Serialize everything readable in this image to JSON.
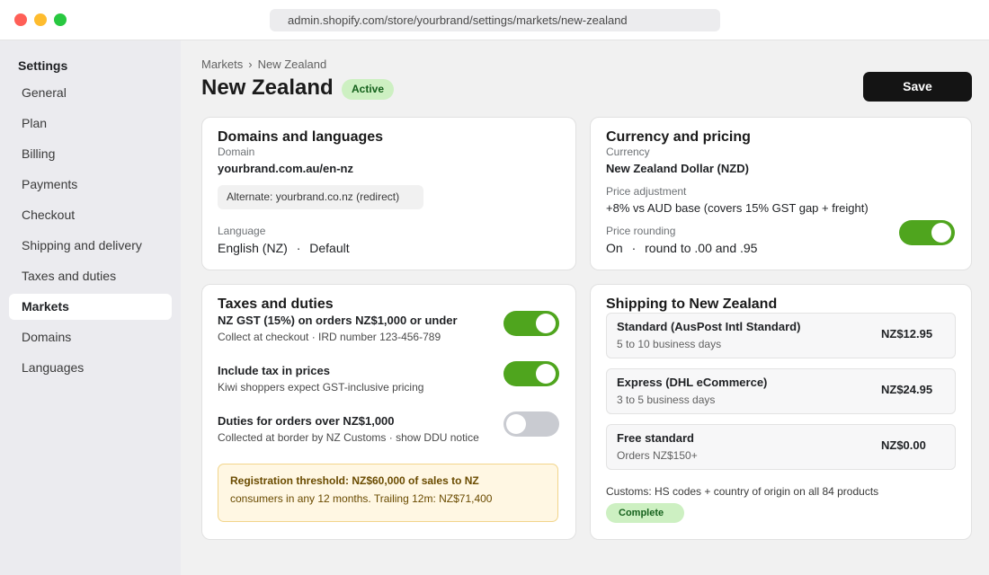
{
  "browser": {
    "url": "admin.shopify.com/store/yourbrand/settings/markets/new-zealand"
  },
  "sidebar": {
    "title": "Settings",
    "items": [
      {
        "label": "General"
      },
      {
        "label": "Plan"
      },
      {
        "label": "Billing"
      },
      {
        "label": "Payments"
      },
      {
        "label": "Checkout"
      },
      {
        "label": "Shipping and delivery"
      },
      {
        "label": "Taxes and duties"
      },
      {
        "label": "Markets",
        "active": true
      },
      {
        "label": "Domains"
      },
      {
        "label": "Languages"
      }
    ]
  },
  "header": {
    "breadcrumb_parent": "Markets",
    "breadcrumb_separator": "›",
    "breadcrumb_current": "New Zealand",
    "title": "New Zealand",
    "status": "Active",
    "save_label": "Save"
  },
  "domains_card": {
    "title": "Domains and languages",
    "domain_label": "Domain",
    "domain_value": "yourbrand.com.au/en-nz",
    "alternate": "Alternate: yourbrand.co.nz  (redirect)",
    "language_label": "Language",
    "language_value": "English (NZ)",
    "language_sep": "·",
    "language_default": "Default"
  },
  "currency_card": {
    "title": "Currency and pricing",
    "currency_label": "Currency",
    "currency_value": "New Zealand Dollar (NZD)",
    "adjustment_label": "Price adjustment",
    "adjustment_value": "+8% vs AUD base (covers 15% GST gap + freight)",
    "rounding_label": "Price rounding",
    "rounding_state": "On",
    "rounding_sep": "·",
    "rounding_value": "round to .00 and .95",
    "rounding_enabled": true
  },
  "taxes_card": {
    "title": "Taxes and duties",
    "rows": [
      {
        "title": "NZ GST (15%) on orders NZ$1,000 or under",
        "desc": "Collect at checkout  ·  IRD number 123-456-789",
        "enabled": true
      },
      {
        "title": "Include tax in prices",
        "desc": "Kiwi shoppers expect GST-inclusive pricing",
        "enabled": true
      },
      {
        "title": "Duties for orders over NZ$1,000",
        "desc": "Collected at border by NZ Customs  ·  show DDU notice",
        "enabled": false
      }
    ],
    "notice_line1": "Registration threshold: NZ$60,000 of sales to NZ",
    "notice_line2": "consumers in any 12 months. Trailing 12m: NZ$71,400"
  },
  "shipping_card": {
    "title": "Shipping to New Zealand",
    "rates": [
      {
        "name": "Standard (AusPost Intl Standard)",
        "desc": "5 to 10 business days",
        "price": "NZ$12.95"
      },
      {
        "name": "Express (DHL eCommerce)",
        "desc": "3 to 5 business days",
        "price": "NZ$24.95"
      },
      {
        "name": "Free standard",
        "desc": "Orders NZ$150+",
        "price": "NZ$0.00"
      }
    ],
    "customs_text": "Customs: HS codes + country of origin on all 84 products",
    "customs_status": "Complete"
  },
  "colors": {
    "toggle_on": "#4fa51e",
    "toggle_off": "#c9cbd1",
    "badge_bg": "#cdf0c2",
    "badge_text": "#14601b",
    "notice_bg": "#fff7e3",
    "primary_button": "#141414"
  }
}
